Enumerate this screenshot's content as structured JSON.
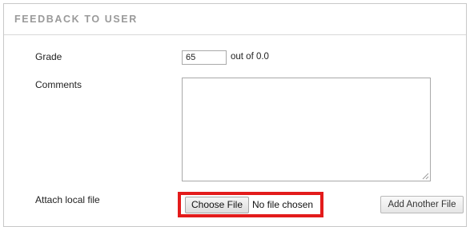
{
  "section": {
    "title": "FEEDBACK TO USER"
  },
  "grade": {
    "label": "Grade",
    "value": "65",
    "suffix": "out of 0.0"
  },
  "comments": {
    "label": "Comments",
    "value": ""
  },
  "attachment": {
    "label": "Attach local file",
    "choose_button": "Choose File",
    "status": "No file chosen",
    "add_another_button": "Add Another File",
    "highlight_color": "#e31b1b"
  }
}
